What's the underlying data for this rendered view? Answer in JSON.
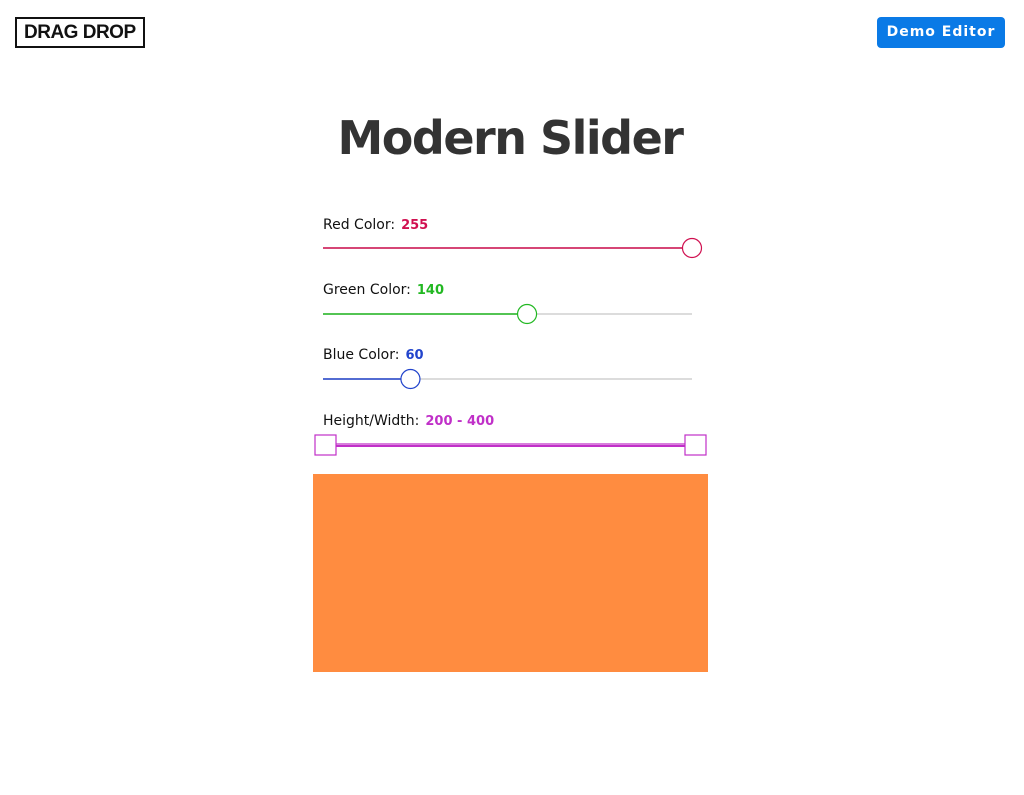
{
  "header": {
    "logo_text": "DRAG DROP",
    "demo_button_label": "Demo Editor"
  },
  "main": {
    "title": "Modern Slider"
  },
  "sliders": {
    "red": {
      "label": "Red Color:",
      "value": "255",
      "fraction": 1.0,
      "color": "#d01050"
    },
    "green": {
      "label": "Green Color:",
      "value": "140",
      "fraction": 0.553,
      "color": "#22b822"
    },
    "blue": {
      "label": "Blue Color:",
      "value": "60",
      "fraction": 0.237,
      "color": "#2244cc"
    },
    "size": {
      "label": "Height/Width:",
      "value": "200 - 400",
      "color": "#c030c8"
    }
  },
  "preview": {
    "color": "#ff8c40"
  },
  "track_color": "#d0d0d0"
}
